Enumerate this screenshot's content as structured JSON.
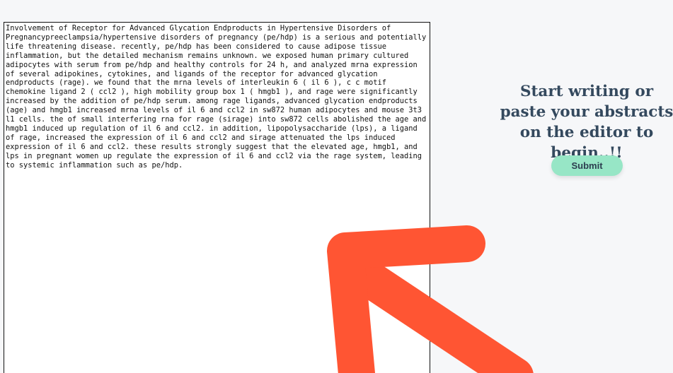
{
  "editor": {
    "text": "Involvement of Receptor for Advanced Glycation Endproducts in Hypertensive Disorders of\nPregnancypreeclampsia/hypertensive disorders of pregnancy (pe/hdp) is a serious and potentially\nlife threatening disease. recently, pe/hdp has been considered to cause adipose tissue\ninflammation, but the detailed mechanism remains unknown. we exposed human primary cultured\nadipocytes with serum from pe/hdp and healthy controls for 24 h, and analyzed mrna expression\nof several adipokines, cytokines, and ligands of the receptor for advanced glycation\nendproducts (rage). we found that the mrna levels of interleukin 6 ( il 6 ), c c motif\nchemokine ligand 2 ( ccl2 ), high mobility group box 1 ( hmgb1 ), and rage were significantly\nincreased by the addition of pe/hdp serum. among rage ligands, advanced glycation endproducts\n(age) and hmgb1 increased mrna levels of il 6 and ccl2 in sw872 human adipocytes and mouse 3t3\nl1 cells. the of small interfering rna for rage (sirage) into sw872 cells abolished the age and\nhmgb1 induced up regulation of il 6 and ccl2. in addition, lipopolysaccharide (lps), a ligand\nof rage, increased the expression of il 6 and ccl2 and sirage attenuated the lps induced\nexpression of il 6 and ccl2. these results strongly suggest that the elevated age, hmgb1, and\nlps in pregnant women up regulate the expression of il 6 and ccl2 via the rage system, leading\nto systemic inflammation such as pe/hdp."
  },
  "sidebar": {
    "prompt": "Start writing or paste your abstracts on the editor to begin..!!",
    "submit_label": "Submit"
  },
  "colors": {
    "prompt_text": "#34495e",
    "submit_bg": "#97e6c6",
    "arrow": "#ff5533"
  }
}
